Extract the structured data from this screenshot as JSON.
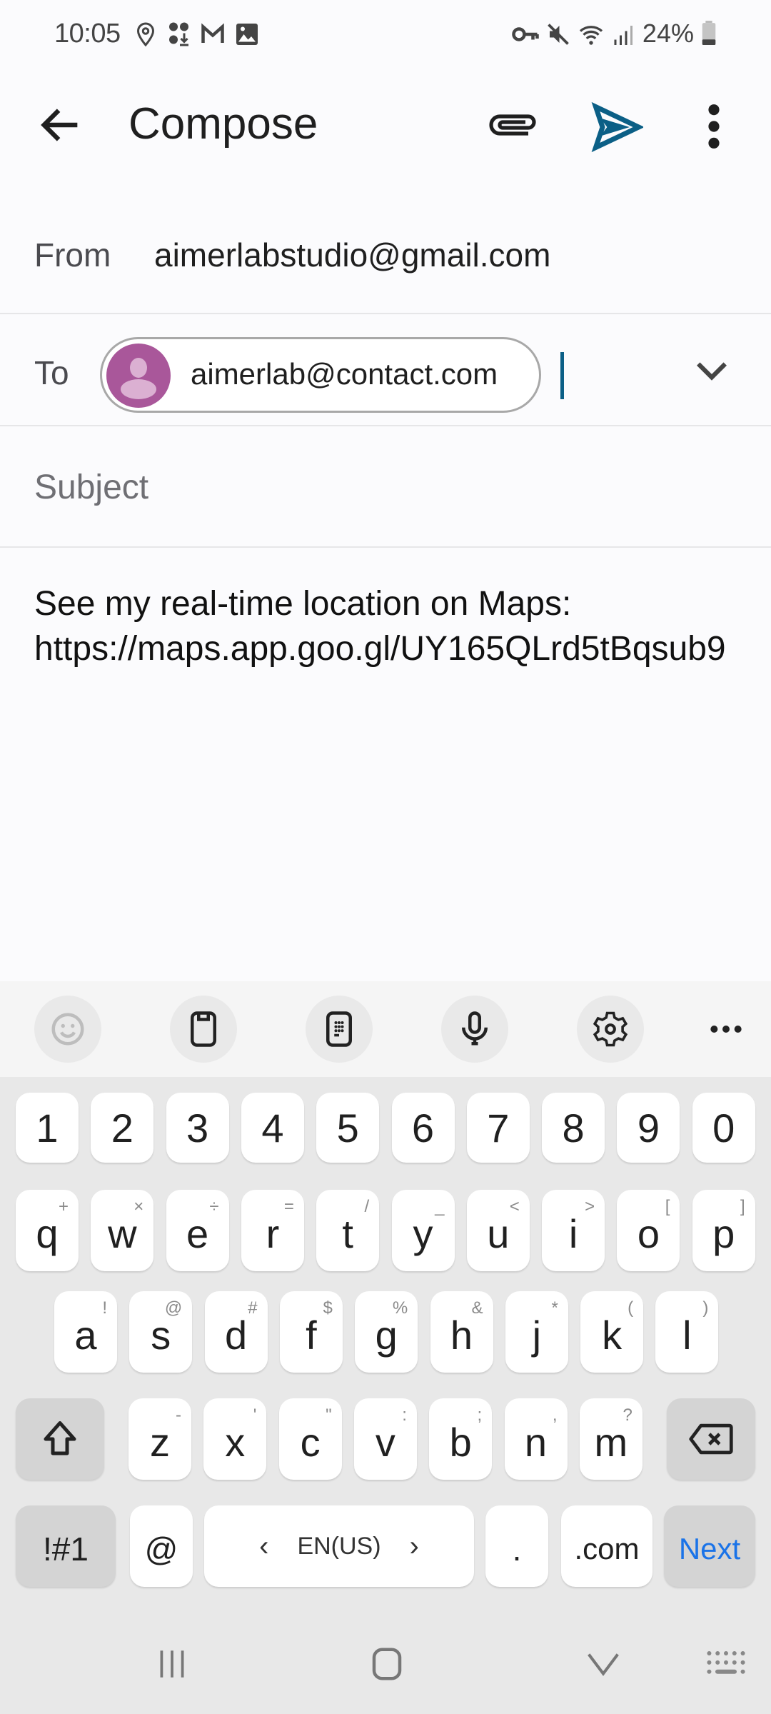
{
  "status_bar": {
    "time": "10:05",
    "left_icons": [
      "location-icon",
      "download-notification-icon",
      "gmail-icon",
      "gallery-icon"
    ],
    "right_icons": [
      "vpn-key-icon",
      "mute-icon",
      "wifi-icon",
      "signal-icon"
    ],
    "battery": "24%"
  },
  "app_bar": {
    "title": "Compose",
    "accent_color": "#0b5f86"
  },
  "from": {
    "label": "From",
    "value": "aimerlabstudio@gmail.com"
  },
  "to": {
    "label": "To",
    "recipients": [
      {
        "email": "aimerlab@contact.com",
        "avatar_color": "#a9579a"
      }
    ]
  },
  "subject": {
    "placeholder": "Subject",
    "value": ""
  },
  "body": {
    "text": "See my real-time location on Maps:\nhttps://maps.app.goo.gl/UY165QLrd5tBqsub9"
  },
  "keyboard": {
    "toolbar": [
      "emoji-icon",
      "clipboard-icon",
      "keypad-icon",
      "microphone-icon",
      "settings-icon",
      "more-icon"
    ],
    "number_row": [
      "1",
      "2",
      "3",
      "4",
      "5",
      "6",
      "7",
      "8",
      "9",
      "0"
    ],
    "row1": [
      {
        "k": "q",
        "h": "+"
      },
      {
        "k": "w",
        "h": "×"
      },
      {
        "k": "e",
        "h": "÷"
      },
      {
        "k": "r",
        "h": "="
      },
      {
        "k": "t",
        "h": "/"
      },
      {
        "k": "y",
        "h": "_"
      },
      {
        "k": "u",
        "h": "<"
      },
      {
        "k": "i",
        "h": ">"
      },
      {
        "k": "o",
        "h": "["
      },
      {
        "k": "p",
        "h": "]"
      }
    ],
    "row2": [
      {
        "k": "a",
        "h": "!"
      },
      {
        "k": "s",
        "h": "@"
      },
      {
        "k": "d",
        "h": "#"
      },
      {
        "k": "f",
        "h": "$"
      },
      {
        "k": "g",
        "h": "%"
      },
      {
        "k": "h",
        "h": "&"
      },
      {
        "k": "j",
        "h": "*"
      },
      {
        "k": "k",
        "h": "("
      },
      {
        "k": "l",
        "h": ")"
      }
    ],
    "row3": [
      {
        "k": "z",
        "h": "-"
      },
      {
        "k": "x",
        "h": "'"
      },
      {
        "k": "c",
        "h": "\""
      },
      {
        "k": "v",
        "h": ":"
      },
      {
        "k": "b",
        "h": ";"
      },
      {
        "k": "n",
        "h": ","
      },
      {
        "k": "m",
        "h": "?"
      }
    ],
    "symbols_label": "!#1",
    "at_label": "@",
    "language_label": "EN(US)",
    "period_label": ".",
    "dotcom_label": ".com",
    "next_label": "Next",
    "next_color": "#1a73e8"
  },
  "nav_bar": [
    "recents-icon",
    "home-icon",
    "hide-keyboard-icon",
    "keyboard-switch-icon"
  ]
}
